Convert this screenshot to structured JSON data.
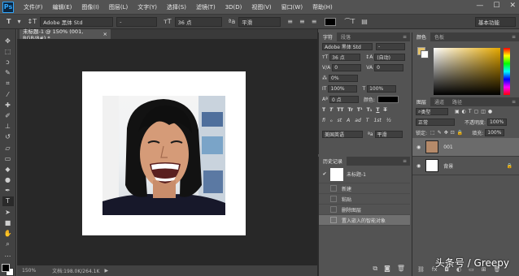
{
  "app": {
    "logo": "Ps"
  },
  "menu": [
    "文件(F)",
    "编辑(E)",
    "图像(I)",
    "图层(L)",
    "文字(Y)",
    "选择(S)",
    "滤镜(T)",
    "3D(D)",
    "视图(V)",
    "窗口(W)",
    "帮助(H)"
  ],
  "window_controls": [
    "—",
    "☐",
    "✕"
  ],
  "options_bar": {
    "tool_glyph": "T",
    "font_family": "Adobe 黑体 Std",
    "font_style": "-",
    "font_size": "36 点",
    "anti_alias": "平滑",
    "workspace": "基本功能"
  },
  "document": {
    "tab_title": "未标题-1 @ 150% (001, RGB/8#) *",
    "tab_close": "×",
    "zoom": "150%",
    "doc_info": "文档:198.0K/264.1K"
  },
  "char_panel": {
    "tabs": [
      "字符",
      "段落"
    ],
    "font_family": "Adobe 黑体 Std",
    "font_style": "-",
    "size": "36 点",
    "leading": "(自动)",
    "kerning": "0",
    "tracking": "0%",
    "vscale": "100%",
    "hscale": "100%",
    "baseline": "0 点",
    "color_label": "颜色:",
    "color": "#000000",
    "style_buttons": [
      "T",
      "T",
      "TT",
      "Tr",
      "T¹",
      "T₁",
      "T",
      "T"
    ],
    "ot_buttons": [
      "fi",
      "ℴ",
      "st",
      "A",
      "ad",
      "T",
      "1st",
      "½"
    ],
    "language": "美国英语",
    "aa": "平滑"
  },
  "history_panel": {
    "tabs": [
      "历史记录"
    ],
    "snapshot": "未标题-1",
    "items": [
      "新建",
      "粘贴",
      "删除图层",
      "置入嵌入的智能对象"
    ]
  },
  "color_panel": {
    "tabs": [
      "颜色",
      "色板"
    ],
    "fg_color": "#e5c36a",
    "bg_color": "#ffffff"
  },
  "layers_panel": {
    "tabs": [
      "图层",
      "通道",
      "路径"
    ],
    "filter": "类型",
    "blend_mode": "正常",
    "opacity_label": "不透明度:",
    "opacity": "100%",
    "lock_label": "锁定:",
    "fill_label": "填充:",
    "fill": "100%",
    "layers": [
      {
        "name": "001",
        "selected": true
      },
      {
        "name": "背景",
        "selected": false
      }
    ]
  },
  "watermark": "头条号 / Greepy"
}
